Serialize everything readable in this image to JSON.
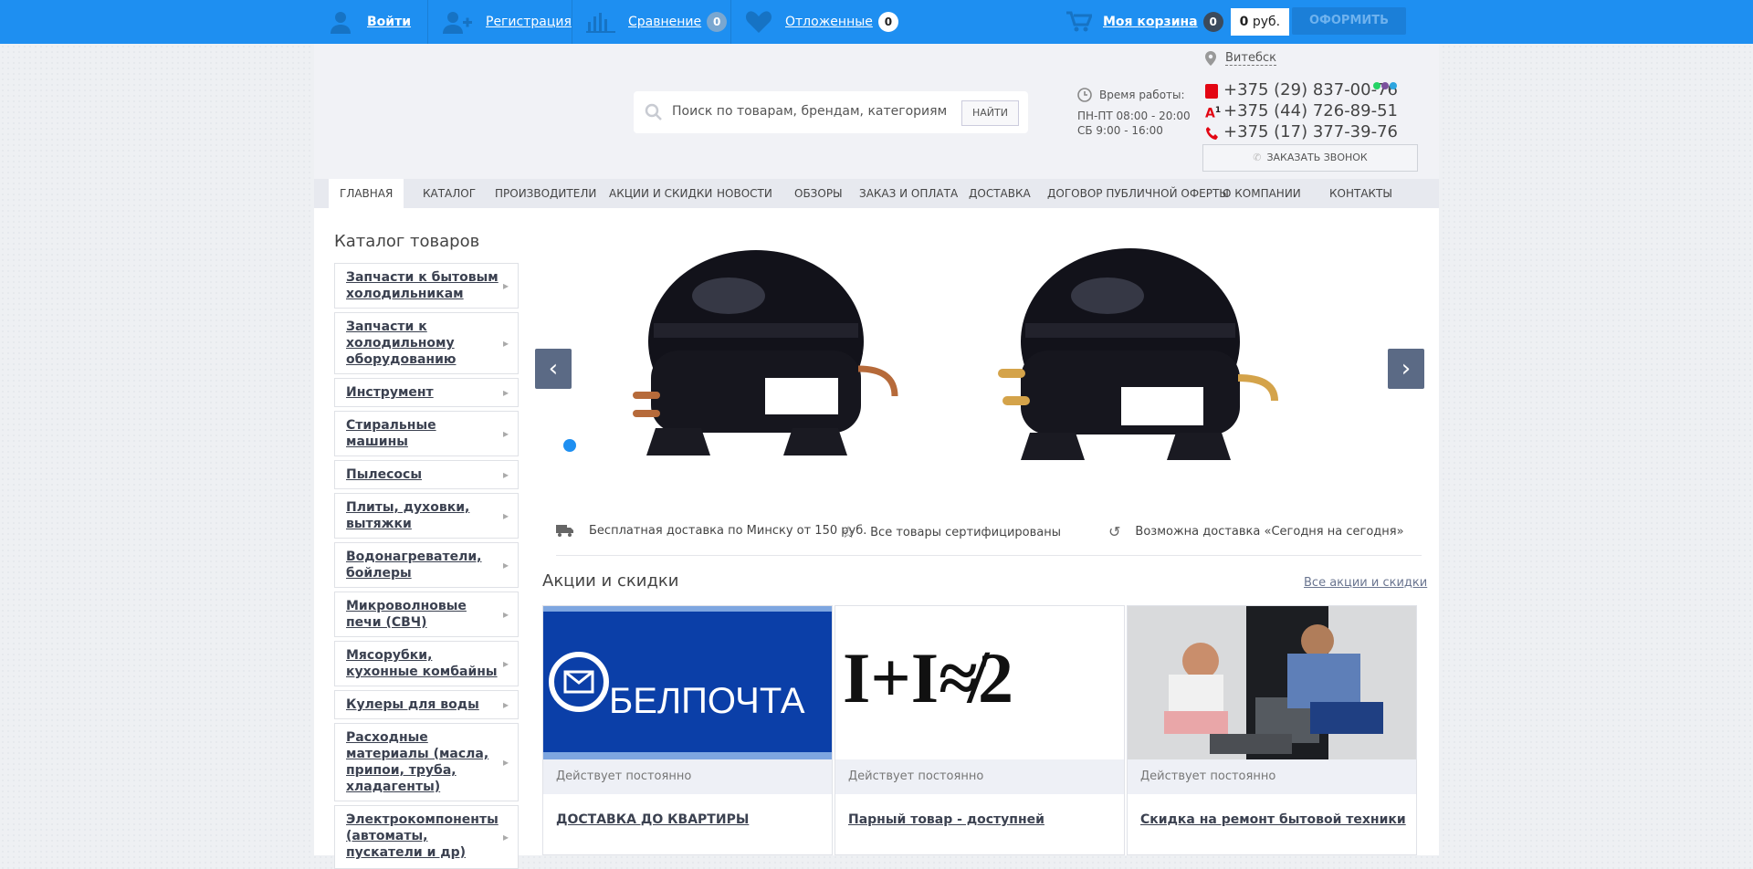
{
  "topbar": {
    "login": "Войти",
    "register": "Регистрация",
    "compare": "Сравнение",
    "compare_count": "0",
    "favorites": "Отложенные",
    "favorites_count": "0",
    "cart": "Моя корзина",
    "cart_count": "0",
    "price_value": "0",
    "price_unit": "руб.",
    "checkout": "ОФОРМИТЬ"
  },
  "header": {
    "city": "Витебск",
    "search_placeholder": "Поиск по товарам, брендам, категориям",
    "search_button": "НАЙТИ",
    "work_hours_label": "Время работы:",
    "hours_line1": "ПН-ПТ 08:00 - 20:00",
    "hours_line2": "СБ 9:00 - 16:00",
    "phones": [
      "+375 (29) 837-00-76",
      "+375 (44) 726-89-51",
      "+375 (17) 377-39-76"
    ],
    "callback": "ЗАКАЗАТЬ ЗВОНОК"
  },
  "nav": [
    "ГЛАВНАЯ",
    "КАТАЛОГ",
    "ПРОИЗВОДИТЕЛИ",
    "АКЦИИ И СКИДКИ",
    "НОВОСТИ",
    "ОБЗОРЫ",
    "ЗАКАЗ И ОПЛАТА",
    "ДОСТАВКА",
    "ДОГОВОР ПУБЛИЧНОЙ ОФЕРТЫ",
    "О КОМПАНИИ",
    "КОНТАКТЫ"
  ],
  "sidebar": {
    "title": "Каталог товаров",
    "items": [
      "Запчасти к бытовым холодильникам",
      "Запчасти к холодильному оборудованию",
      "Инструмент",
      "Стиральные машины",
      "Пылесосы",
      "Плиты, духовки, вытяжки",
      "Водонагреватели, бойлеры",
      "Микроволновые печи (СВЧ)",
      "Мясорубки, кухонные комбайны",
      "Кулеры для воды",
      "Расходные материалы (масла, припои, труба, хладагенты)",
      "Электрокомпоненты (автоматы, пускатели и др)"
    ]
  },
  "features": [
    "Бесплатная доставка по Минску от 150 руб.",
    "Все товары сертифицированы",
    "Возможна доставка «Сегодня на сегодня»"
  ],
  "promos": {
    "title": "Акции и скидки",
    "all_link": "Все акции и скидки",
    "cards": [
      {
        "status": "Действует постоянно",
        "title": "ДОСТАВКА ДО КВАРТИРЫ",
        "image_text": "БЕЛПОЧТА"
      },
      {
        "status": "Действует постоянно",
        "title": "Парный товар - доступней",
        "image_text": "I+I≉2"
      },
      {
        "status": "Действует постоянно",
        "title": "Скидка на ремонт бытовой техники"
      }
    ]
  },
  "colors": {
    "accent": "#1e8ff1",
    "nav_bg": "#e7e9ef",
    "header_bg": "#f1f2f6"
  }
}
